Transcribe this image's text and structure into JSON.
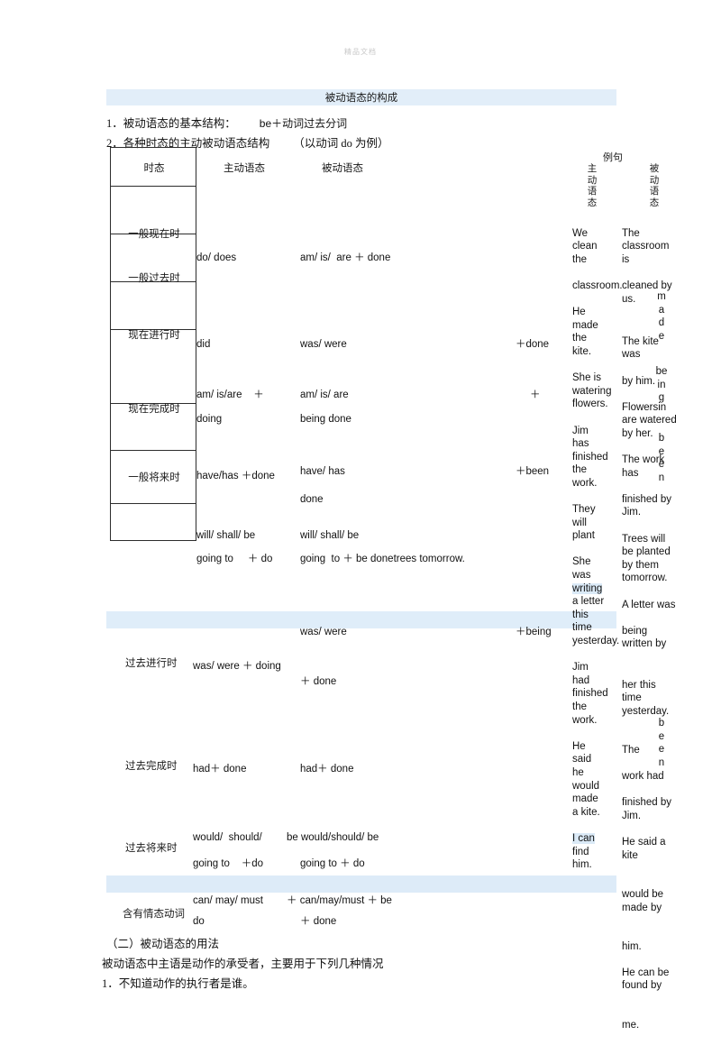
{
  "watermark": "精品文档",
  "title": "被动语态的构成",
  "intro": [
    {
      "num": "1．",
      "text": "被动语态的基本结构：",
      "formula": "be＋动词过去分词"
    },
    {
      "num": "2．",
      "text": "各种时态的主动被动语态结构",
      "formula": "（以动词 do 为例）"
    }
  ],
  "table": {
    "headers": {
      "tense": "时态",
      "active": "主动语态",
      "passive": "被动语态"
    },
    "rows": [
      {
        "tense": "一般现在时",
        "active": "do/ does",
        "passive": "am/ is/  are ＋ done",
        "tail": ""
      },
      {
        "tense": "一般过去时",
        "active": "did",
        "passive": "was/ were",
        "tail": "＋done"
      },
      {
        "tense": "现在进行时",
        "active_l1": "am/ is/are    ＋",
        "active_l2": "doing",
        "passive_l1": "am/ is/ are",
        "passive_l2": "being done",
        "tail": "＋"
      },
      {
        "tense": "现在完成时",
        "active": "have/has ＋done",
        "passive_l1": "have/ has",
        "passive_l2": "done",
        "tail": "＋been"
      },
      {
        "tense": "一般将来时",
        "active_l1": "will/ shall/ be",
        "active_l2": "going to     ＋ do",
        "passive_l1": "will/ shall/ be",
        "passive_l2": "going  to ＋ be donetrees tomorrow.",
        "tail": ""
      },
      {
        "tense": "过去进行时",
        "active": "was/ were ＋ doing",
        "passive_l1": "was/ were",
        "passive_l2": "＋ done",
        "tail": "＋being"
      },
      {
        "tense": "过去完成时",
        "active": "had＋ done",
        "passive": "had＋ done",
        "tail": ""
      },
      {
        "tense": "过去将来时",
        "active_l1": "would/  should/",
        "active_l2": "going to    ＋do",
        "passive_l1": "be would/should/ be",
        "passive_l2": "going to ＋ do",
        "tail": ""
      },
      {
        "tense": "含有情态动词",
        "active_l1": "can/ may/ must",
        "active_l2": "do",
        "passive_l1": "＋ can/may/must ＋ be",
        "passive_l2": "＋ done",
        "tail": ""
      }
    ]
  },
  "examples": {
    "heading": "例句",
    "active_label": [
      "主",
      "动",
      "语",
      "态"
    ],
    "passive_label": [
      "被",
      "动",
      "语",
      "态"
    ],
    "active_sentences": [
      "We clean the",
      "classroom.",
      "He made the kite.",
      "She is watering flowers.",
      "Jim has finished the work.",
      "They will plant",
      "She was writing a letter this time yesterday.",
      "Jim had finished the work.",
      "He said he would made a kite.",
      "I can find him."
    ],
    "passive_sentences": [
      "The classroom is",
      "cleaned by us.",
      "The kite was",
      "by him.",
      "Flowersin are watered by her.",
      "The work has",
      "finished by Jim.",
      "Trees will be planted by them tomorrow.",
      "A letter was",
      "being written by",
      "her this time yesterday.",
      "The",
      "work had",
      "finished by Jim.",
      "He said a kite",
      "would be made by",
      "him.",
      "He can be found by",
      "me."
    ],
    "overflow_letters": [
      [
        "m",
        "a",
        "d",
        "e"
      ],
      [
        "be",
        "in",
        "g"
      ],
      [
        "b",
        "e",
        "e",
        "n"
      ],
      [
        "b",
        "e",
        "e",
        "n"
      ]
    ]
  },
  "footer": {
    "section": "（二）被动语态的用法",
    "line1": "被动语态中主语是动作的承受者，主要用于下列几种情况",
    "line2_num": "1．",
    "line2": "不知道动作的执行者是谁。"
  },
  "colors": {
    "band": "#e2eef9",
    "highlight": "#dbeaf7",
    "border": "#2d2d2d",
    "text": "#111111"
  }
}
